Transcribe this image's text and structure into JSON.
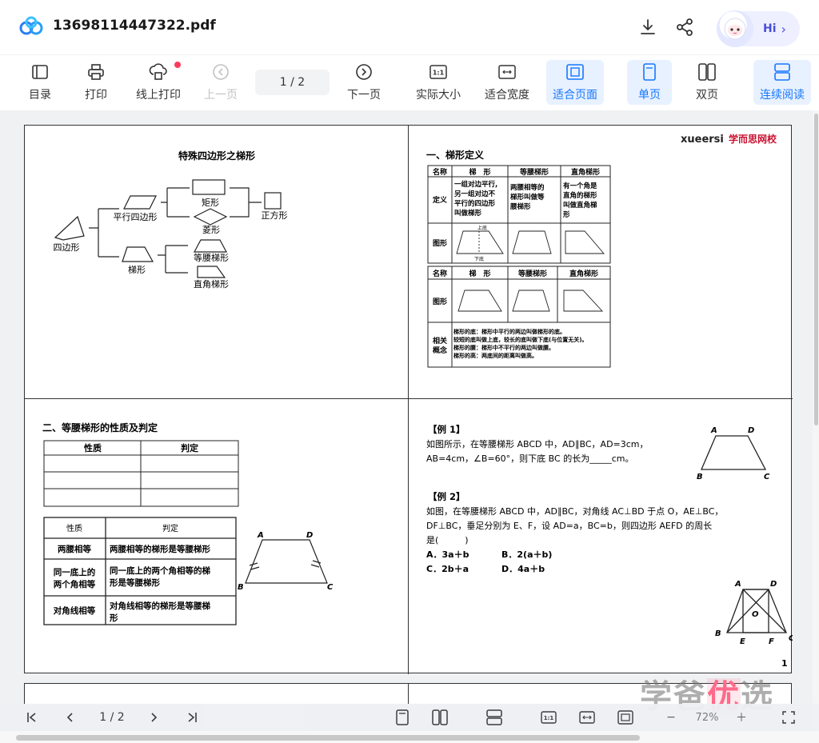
{
  "header": {
    "filename": "13698114447322.pdf",
    "hi_label": "Hi",
    "hi_chevron": "›"
  },
  "toolbar": {
    "toc": "目录",
    "print": "打印",
    "online_print": "线上打印",
    "prev_page": "上一页",
    "page_indicator": "1  / 2",
    "next_page": "下一页",
    "actual_size": "实际大小",
    "fit_width": "适合宽度",
    "fit_page": "适合页面",
    "single_page": "单页",
    "double_page": "双页",
    "continuous": "连续阅读"
  },
  "page1": {
    "q1": {
      "title": "特殊四边形之梯形",
      "labels": {
        "quadrilateral": "四边形",
        "parallelogram": "平行四边形",
        "rectangle": "矩形",
        "rhombus": "菱形",
        "square": "正方形",
        "trapezoid": "梯形",
        "isosceles": "等腰梯形",
        "right": "直角梯形"
      }
    },
    "q2": {
      "brand": "xueersi",
      "brand_cn": "学而思网校",
      "section": "一、梯形定义",
      "t1": {
        "headers": [
          "名称",
          "梯　形",
          "等腰梯形",
          "直角梯形"
        ],
        "def_label": "定义",
        "def1": [
          "一组对边平行,",
          "另一组对边不",
          "平行的四边形",
          "叫做梯形"
        ],
        "def2": [
          "两腰相等的",
          "梯形叫做等",
          "腰梯形"
        ],
        "def3": [
          "有一个角是",
          "直角的梯形",
          "叫做直角梯",
          "形"
        ],
        "fig_label": "图形",
        "upper": "上底",
        "lower": "下底",
        "leg": "腰"
      },
      "t2": {
        "headers": [
          "名称",
          "梯　形",
          "等腰梯形",
          "直角梯形"
        ],
        "fig_label": "图形",
        "concept_label": [
          "相关",
          "概念"
        ],
        "concepts": [
          "梯形的底：梯形中平行的两边叫做梯形的底。",
          "较短的底叫做上底，较长的底叫做下底(与位置无关)。",
          "梯形的腰：梯形中不平行的两边叫做腰。",
          "梯形的高：两底间的距离叫做高。"
        ]
      }
    },
    "q3": {
      "section": "二、等腰梯形的性质及判定",
      "t1_headers": [
        "性质",
        "判定"
      ],
      "t2_headers": [
        "性质",
        "判定"
      ],
      "rows": [
        {
          "prop": [
            "两腰相等"
          ],
          "judge": [
            "两腰相等的梯形是等腰梯形"
          ]
        },
        {
          "prop": [
            "同一底上的",
            "两个角相等"
          ],
          "judge": [
            "同一底上的两个角相等的梯",
            "形是等腰梯形"
          ]
        },
        {
          "prop": [
            "对角线相等"
          ],
          "judge": [
            "对角线相等的梯形是等腰梯",
            "形"
          ]
        }
      ]
    },
    "q4": {
      "ex1_title": "【例 1】",
      "ex1_lines": [
        "如图所示，在等腰梯形 ABCD 中，AD∥BC，AD=3cm，",
        "AB=4cm，∠B=60°，则下底 BC 的长为_____cm。"
      ],
      "ex2_title": "【例 2】",
      "ex2_lines": [
        "如图，在等腰梯形 ABCD 中，AD∥BC，对角线 AC⊥BD 于点 O，AE⊥BC，",
        "DF⊥BC，垂足分别为 E、F，设 AD=a，BC=b，则四边形 AEFD 的周长",
        "是(　　　)"
      ],
      "options": [
        "A．3a＋b",
        "B．2(a＋b)",
        "C．2b＋a",
        "D．4a＋b"
      ],
      "page_num": "1"
    }
  },
  "bottombar": {
    "page_indicator": "1  / 2",
    "zoom": "72%",
    "minus": "−",
    "plus": "＋"
  },
  "watermark": {
    "text1": "学爸",
    "text2": "优",
    "text3": "选"
  },
  "colors": {
    "accent": "#1677ff",
    "active_bg": "#e8f1ff",
    "brand_red": "#c8102e",
    "dot_red": "#ff3b5c"
  }
}
